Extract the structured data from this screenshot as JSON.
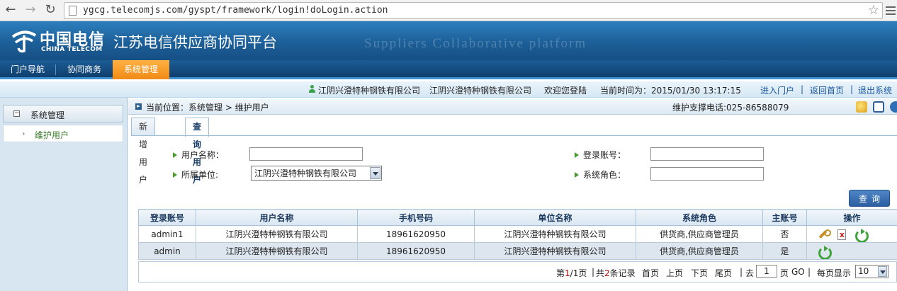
{
  "browser": {
    "url": "ygcg.telecomjs.com/gyspt/framework/login!doLogin.action"
  },
  "header": {
    "logo_cn": "中国电信",
    "logo_en": "CHINA TELECOM",
    "platform_title": "江苏电信供应商协同平台",
    "platform_subtitle": "Suppliers Collaborative platform"
  },
  "topnav": {
    "items": [
      {
        "label": "门户导航",
        "active": false
      },
      {
        "label": "协同商务",
        "active": false
      },
      {
        "label": "系统管理",
        "active": true
      }
    ]
  },
  "infobar": {
    "company1": "江阴兴澄特种钢铁有限公司",
    "company2": "江阴兴澄特种钢铁有限公司",
    "welcome": "欢迎您登陆",
    "time": "当前时间为：2015/01/30 13:17:15",
    "links": [
      "进入门户",
      "返回首页",
      "退出系统"
    ],
    "separator": "|"
  },
  "sidebar": {
    "section": "系统管理",
    "collapse_symbol": "−",
    "items": [
      {
        "label": "维护用户"
      }
    ]
  },
  "main": {
    "breadcrumb": "当前位置：系统管理 > 维护用户",
    "support_phone": "维护支撑电话:025-86588079",
    "tabs": [
      {
        "label": "新增用户",
        "active": false
      },
      {
        "label": "查询用户",
        "active": true
      }
    ],
    "form": {
      "username_label": "用户名称：",
      "username_value": "",
      "account_label": "登录账号：",
      "account_value": "",
      "unit_label": "所属单位:",
      "unit_value": "江阴兴澄特种钢铁有限公司",
      "role_label": "系统角色：",
      "role_value": ""
    },
    "query_button": "查询"
  },
  "table": {
    "headers": [
      "登录账号",
      "用户名称",
      "手机号码",
      "单位名称",
      "系统角色",
      "主账号",
      "操作"
    ],
    "rows": [
      {
        "account": "admin1",
        "name": "江阴兴澄特种钢铁有限公司",
        "phone": "18961620950",
        "unit": "江阴兴澄特种钢铁有限公司",
        "role": "供货商,供应商管理员",
        "primary": "否",
        "actions": [
          "wrench-icon",
          "delete-icon",
          "refresh-icon"
        ]
      },
      {
        "account": "admin",
        "name": "江阴兴澄特种钢铁有限公司",
        "phone": "18961620950",
        "unit": "江阴兴澄特种钢铁有限公司",
        "role": "供货商,供应商管理员",
        "primary": "是",
        "actions": [
          "refresh-icon"
        ]
      }
    ]
  },
  "pager": {
    "page_prefix": "第",
    "current_page": "1",
    "page_sep": "/",
    "total_pages": "1",
    "page_suffix": "页",
    "total_prefix": "共",
    "total_records": "2",
    "total_suffix": "条记录",
    "first": "首页",
    "prev": "上页",
    "next": "下页",
    "last": "尾页",
    "goto_label": "去",
    "goto_value": "1",
    "goto_suffix": "页",
    "go": "GO",
    "per_page_label": "每页显示",
    "per_page_value": "10"
  },
  "colors": {
    "banner": "#1d5f98",
    "nav_active": "#f08a16",
    "link": "#1a57a0",
    "pager_highlight": "#c00000"
  }
}
